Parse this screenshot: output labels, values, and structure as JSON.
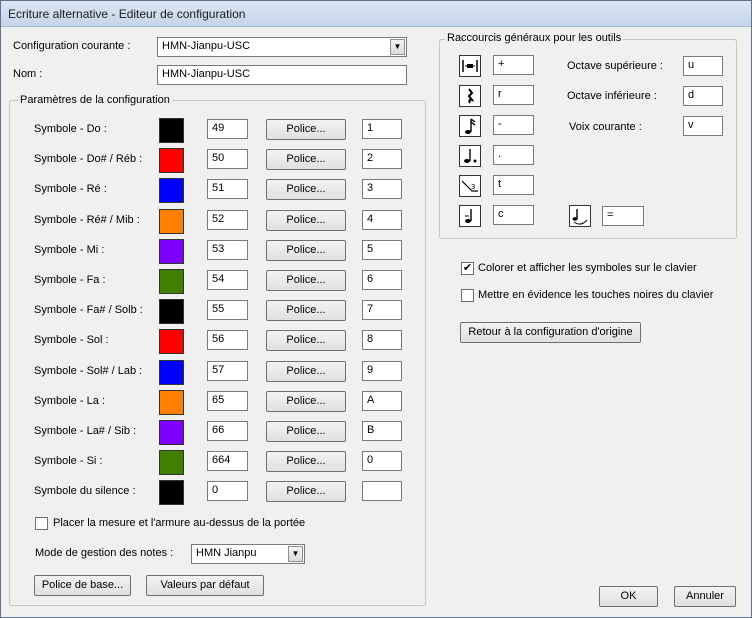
{
  "window": {
    "title": "Ecriture alternative - Editeur de configuration"
  },
  "config": {
    "current_label": "Configuration courante :",
    "current_value": "HMN-Jianpu-USC",
    "name_label": "Nom :",
    "name_value": "HMN-Jianpu-USC"
  },
  "params": {
    "group_title": "Paramètres de la configuration",
    "font_button_label": "Police...",
    "rows": [
      {
        "label": "Symbole - Do :",
        "color": "#000000",
        "code": "49",
        "shortcut": "1"
      },
      {
        "label": "Symbole - Do# / Réb :",
        "color": "#ff0000",
        "code": "50",
        "shortcut": "2"
      },
      {
        "label": "Symbole - Ré :",
        "color": "#0000ff",
        "code": "51",
        "shortcut": "3"
      },
      {
        "label": "Symbole - Ré# / Mib :",
        "color": "#ff8000",
        "code": "52",
        "shortcut": "4"
      },
      {
        "label": "Symbole - Mi :",
        "color": "#8000ff",
        "code": "53",
        "shortcut": "5"
      },
      {
        "label": "Symbole - Fa :",
        "color": "#408000",
        "code": "54",
        "shortcut": "6"
      },
      {
        "label": "Symbole - Fa# / Solb :",
        "color": "#000000",
        "code": "55",
        "shortcut": "7"
      },
      {
        "label": "Symbole - Sol :",
        "color": "#ff0000",
        "code": "56",
        "shortcut": "8"
      },
      {
        "label": "Symbole - Sol# / Lab :",
        "color": "#0000ff",
        "code": "57",
        "shortcut": "9"
      },
      {
        "label": "Symbole - La :",
        "color": "#ff8000",
        "code": "65",
        "shortcut": "A"
      },
      {
        "label": "Symbole - La# / Sib :",
        "color": "#8000ff",
        "code": "66",
        "shortcut": "B"
      },
      {
        "label": "Symbole - Si :",
        "color": "#408000",
        "code": "664",
        "shortcut": "0"
      },
      {
        "label": "Symbole du silence :",
        "color": "#000000",
        "code": "0",
        "shortcut": ""
      }
    ],
    "place_measure_label": "Placer la mesure et l'armure au-dessus de la portée",
    "place_measure_checked": false,
    "mode_label": "Mode de gestion des notes :",
    "mode_value": "HMN Jianpu",
    "base_font_button": "Police de base...",
    "defaults_button": "Valeurs par défaut"
  },
  "shortcuts": {
    "group_title": "Raccourcis généraux pour les outils",
    "tools": [
      {
        "icon": "measure-rest-icon",
        "value": "+"
      },
      {
        "icon": "quarter-rest-icon",
        "value": "r"
      },
      {
        "icon": "sixteenth-note-icon",
        "value": "-"
      },
      {
        "icon": "dotted-note-icon",
        "value": "."
      },
      {
        "icon": "triplet-icon",
        "value": "t"
      },
      {
        "icon": "tie-note-icon",
        "value": "c"
      }
    ],
    "extra_tool": {
      "icon": "slur-note-icon",
      "value": "="
    },
    "octave_up_label": "Octave supérieure :",
    "octave_up_value": "u",
    "octave_down_label": "Octave inférieure :",
    "octave_down_value": "d",
    "current_voice_label": "Voix courante :",
    "current_voice_value": "v"
  },
  "options": {
    "color_keyboard_label": "Colorer et afficher les symboles sur le clavier",
    "color_keyboard_checked": true,
    "highlight_black_keys_label": "Mettre en évidence les touches noires du clavier",
    "highlight_black_keys_checked": false,
    "reset_button": "Retour à la configuration d'origine"
  },
  "dialog": {
    "ok": "OK",
    "cancel": "Annuler"
  },
  "check_mark": "✔"
}
